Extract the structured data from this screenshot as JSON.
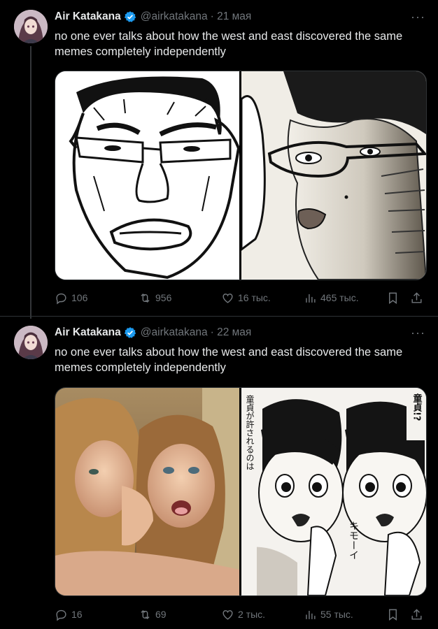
{
  "colors": {
    "accent": "#1d9bf0",
    "text": "#e7e9ea",
    "muted": "#71767b",
    "bg": "#000000"
  },
  "tweets": [
    {
      "author": {
        "name": "Air Katakana",
        "handle": "@airkatakana",
        "date": "· 21 мая"
      },
      "text": "no one ever talks about how the west and east discovered the same memes completely independently",
      "media": {
        "left": "wojak-style drawing",
        "right": "manga face with glasses"
      },
      "stats": {
        "replies": "106",
        "reposts": "956",
        "likes": "16 тыс.",
        "views": "465 тыс."
      }
    },
    {
      "author": {
        "name": "Air Katakana",
        "handle": "@airkatakana",
        "date": "· 22 мая"
      },
      "text": "no one ever talks about how the west and east discovered the same memes completely independently",
      "media": {
        "left": "two girls whispering photo",
        "right": "manga two girls whispering",
        "manga_text_1": "童貞が許されるのは",
        "manga_text_2": "童貞!?",
        "manga_text_3": "キモーイ"
      },
      "stats": {
        "replies": "16",
        "reposts": "69",
        "likes": "2 тыс.",
        "views": "55 тыс."
      }
    }
  ]
}
